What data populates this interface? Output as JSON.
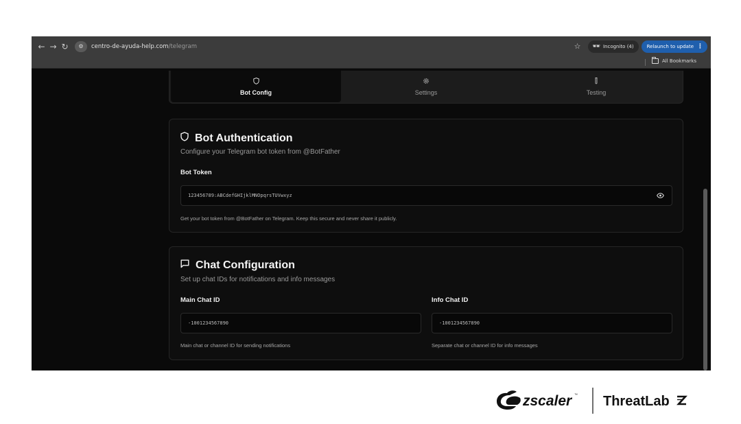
{
  "browser": {
    "url_host": "centro-de-ayuda-help.com",
    "url_path": "/telegram",
    "incognito_label": "Incognito (4)",
    "relaunch_label": "Relaunch to update",
    "all_bookmarks_label": "All Bookmarks"
  },
  "tabs": [
    {
      "label": "Bot Config",
      "icon": "shield-icon",
      "active": true
    },
    {
      "label": "Settings",
      "icon": "gear-icon",
      "active": false
    },
    {
      "label": "Testing",
      "icon": "test-tube-icon",
      "active": false
    }
  ],
  "auth": {
    "title": "Bot Authentication",
    "subtitle": "Configure your Telegram bot token from @BotFather",
    "token_label": "Bot Token",
    "token_value": "123456789:ABCdefGHIjklMNOpqrsTUVwxyz",
    "token_help": "Get your bot token from @BotFather on Telegram. Keep this secure and never share it publicly."
  },
  "chat": {
    "title": "Chat Configuration",
    "subtitle": "Set up chat IDs for notifications and info messages",
    "main_label": "Main Chat ID",
    "main_value": "-1001234567890",
    "main_help": "Main chat or channel ID for sending notifications",
    "info_label": "Info Chat ID",
    "info_value": "-1001234567890",
    "info_help": "Separate chat or channel ID for info messages"
  },
  "branding": {
    "logo_text": "zscaler",
    "lab_text": "ThreatLabz"
  },
  "colors": {
    "accent": "#1f5fad",
    "background": "#0a0a0a",
    "card": "#0e0e0e"
  }
}
